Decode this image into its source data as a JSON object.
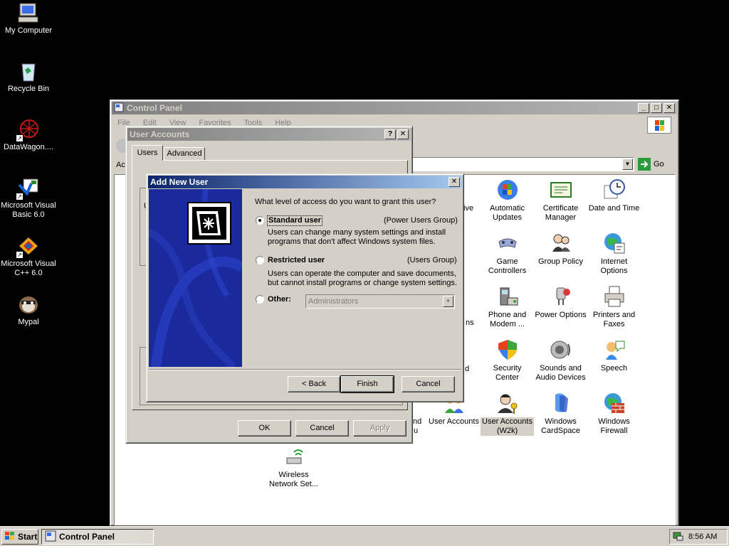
{
  "desktop": {
    "icons": [
      {
        "label": "My Computer"
      },
      {
        "label": "Recycle Bin"
      },
      {
        "label": "DataWagon...."
      },
      {
        "label": "Microsoft Visual Basic 6.0"
      },
      {
        "label": "Microsoft Visual C++ 6.0"
      },
      {
        "label": "Mypal"
      }
    ]
  },
  "control_panel": {
    "title": "Control Panel",
    "menu": [
      "File",
      "Edit",
      "View",
      "Favorites",
      "Tools",
      "Help"
    ],
    "address_label": "Ac",
    "go_label": "Go",
    "items": [
      {
        "label": "Automatic Updates",
        "icon": "automatic-updates-icon"
      },
      {
        "label": "Certificate Manager",
        "icon": "certificate-icon"
      },
      {
        "label": "Date and Time",
        "icon": "clock-icon"
      },
      {
        "label": "Game Controllers",
        "icon": "gamepad-icon"
      },
      {
        "label": "Group Policy",
        "icon": "group-policy-icon"
      },
      {
        "label": "Internet Options",
        "icon": "globe-icon"
      },
      {
        "label": "Phone and Modem ...",
        "icon": "phone-icon"
      },
      {
        "label": "Power Options",
        "icon": "power-icon"
      },
      {
        "label": "Printers and Faxes",
        "icon": "printer-icon"
      },
      {
        "label": "Security Center",
        "icon": "shield-icon"
      },
      {
        "label": "Sounds and Audio Devices",
        "icon": "speaker-icon"
      },
      {
        "label": "Speech",
        "icon": "speech-icon"
      },
      {
        "label": "User Accounts",
        "icon": "users-icon"
      },
      {
        "label": "User Accounts (W2k)",
        "icon": "user-key-icon"
      },
      {
        "label": "Windows CardSpace",
        "icon": "cardspace-icon"
      },
      {
        "label": "Windows Firewall",
        "icon": "firewall-icon"
      },
      {
        "label": "Wireless Network Set...",
        "icon": "wireless-icon"
      }
    ],
    "partial_labels": [
      "ive",
      "ns",
      "d",
      "nd",
      "u"
    ]
  },
  "user_accounts": {
    "title": "User Accounts",
    "help_btn": "?",
    "tabs": [
      "Users",
      "Advanced"
    ],
    "ok": "OK",
    "cancel": "Cancel",
    "apply": "Apply",
    "fragment": "U"
  },
  "wizard": {
    "title": "Add New User",
    "question": "What level of access do you want to grant this user?",
    "options": [
      {
        "label": "Standard user",
        "group": "(Power Users Group)",
        "desc1": "Users can change many system settings and install",
        "desc2": "programs that don't affect Windows system files."
      },
      {
        "label": "Restricted user",
        "group": "(Users Group)",
        "desc1": "Users can operate the computer and save documents,",
        "desc2": "but cannot install programs or change system settings."
      }
    ],
    "other_label": "Other:",
    "other_value": "Administrators",
    "back": "< Back",
    "finish": "Finish",
    "cancel": "Cancel"
  },
  "taskbar": {
    "start": "Start",
    "task": "Control Panel",
    "clock": "8:56 AM"
  }
}
